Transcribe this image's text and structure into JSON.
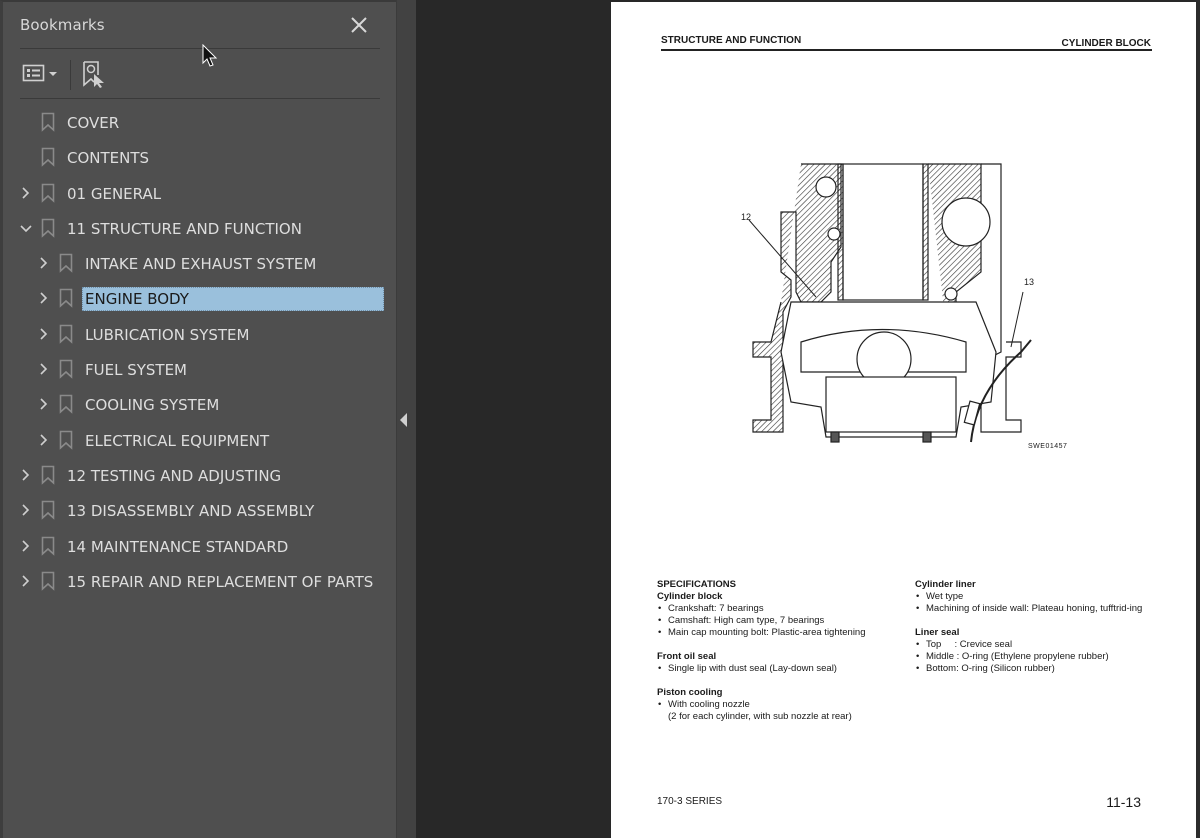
{
  "panel": {
    "title": "Bookmarks",
    "close_icon": "close-icon",
    "toolbar": {
      "options_icon": "list-options-icon",
      "find_bookmark_icon": "find-current-bookmark-icon"
    }
  },
  "bookmarks": [
    {
      "label": "COVER",
      "level": 0,
      "expander": "none",
      "selected": false
    },
    {
      "label": "CONTENTS",
      "level": 0,
      "expander": "none",
      "selected": false
    },
    {
      "label": "01 GENERAL",
      "level": 0,
      "expander": "collapsed",
      "selected": false
    },
    {
      "label": "11 STRUCTURE AND FUNCTION",
      "level": 0,
      "expander": "expanded",
      "selected": false
    },
    {
      "label": "INTAKE AND EXHAUST SYSTEM",
      "level": 1,
      "expander": "collapsed",
      "selected": false
    },
    {
      "label": "ENGINE BODY",
      "level": 1,
      "expander": "collapsed",
      "selected": true
    },
    {
      "label": "LUBRICATION SYSTEM",
      "level": 1,
      "expander": "collapsed",
      "selected": false
    },
    {
      "label": "FUEL SYSTEM",
      "level": 1,
      "expander": "collapsed",
      "selected": false
    },
    {
      "label": "COOLING SYSTEM",
      "level": 1,
      "expander": "collapsed",
      "selected": false
    },
    {
      "label": "ELECTRICAL EQUIPMENT",
      "level": 1,
      "expander": "collapsed",
      "selected": false
    },
    {
      "label": "12 TESTING AND ADJUSTING",
      "level": 0,
      "expander": "collapsed",
      "selected": false
    },
    {
      "label": "13 DISASSEMBLY AND ASSEMBLY",
      "level": 0,
      "expander": "collapsed",
      "selected": false
    },
    {
      "label": "14 MAINTENANCE STANDARD",
      "level": 0,
      "expander": "collapsed",
      "selected": false
    },
    {
      "label": "15 REPAIR AND REPLACEMENT OF PARTS",
      "level": 0,
      "expander": "collapsed",
      "selected": false
    }
  ],
  "splitter": {
    "icon": "collapse-left-arrow-icon"
  },
  "page": {
    "header_left": "STRUCTURE AND FUNCTION",
    "header_right": "CYLINDER BLOCK",
    "figure": {
      "callouts": [
        "12",
        "13"
      ],
      "code": "SWE01457",
      "subject": "cylinder block cross-section"
    },
    "specs_left": {
      "title": "SPECIFICATIONS",
      "sections": [
        {
          "heading": "Cylinder block",
          "items": [
            "Crankshaft: 7 bearings",
            "Camshaft: High cam type, 7 bearings",
            "Main cap mounting bolt: Plastic-area tightening"
          ]
        },
        {
          "heading": "Front oil seal",
          "items": [
            "Single lip with dust seal (Lay-down seal)"
          ]
        },
        {
          "heading": "Piston cooling",
          "items": [
            "With cooling nozzle\n(2 for each cylinder, with sub nozzle at rear)"
          ]
        }
      ]
    },
    "specs_right": {
      "sections": [
        {
          "heading": "Cylinder liner",
          "items": [
            "Wet type",
            "Machining of inside wall: Plateau honing, tufftrid-ing"
          ]
        },
        {
          "heading": "Liner seal",
          "items": [
            "Top     : Crevice seal",
            "Middle : O-ring (Ethylene propylene rubber)",
            "Bottom: O-ring (Silicon rubber)"
          ]
        }
      ]
    },
    "footer_left": "170-3 SERIES",
    "footer_right": "11-13"
  },
  "colors": {
    "panel_bg": "#4f4f4f",
    "selection_bg": "#9ac0dc",
    "viewer_bg": "#282828",
    "text": "#dedede"
  }
}
